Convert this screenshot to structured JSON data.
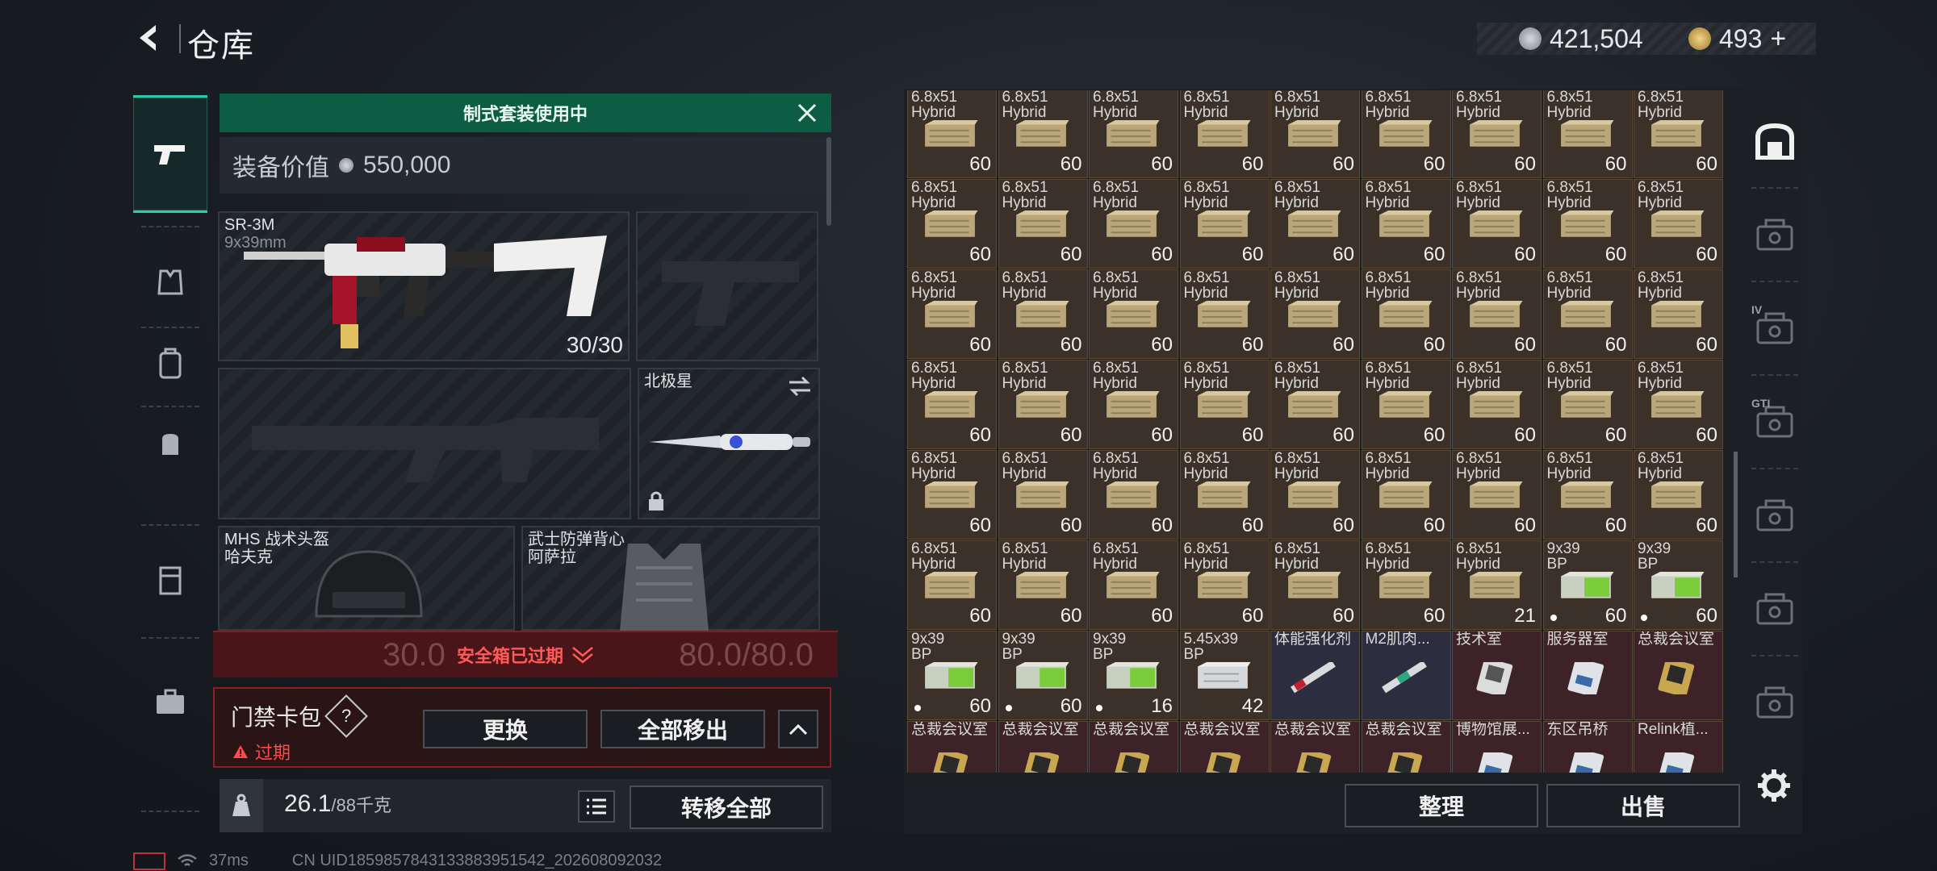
{
  "header": {
    "title": "仓库"
  },
  "currency": {
    "silver": "421,504",
    "gold": "493",
    "plus": "+"
  },
  "banner": {
    "text": "制式套装使用中"
  },
  "equipment": {
    "value_label": "装备价值",
    "value": "550,000",
    "primary": {
      "name": "SR-3M",
      "caliber": "9x39mm",
      "ammo": "30/30"
    },
    "melee": {
      "name": "北极星"
    },
    "helmet": {
      "name1": "MHS 战术头盔",
      "name2": "哈夫克",
      "durability": "30.0"
    },
    "armor": {
      "name1": "武士防弹背心",
      "name2": "阿萨拉",
      "durability": "80.0/80.0"
    }
  },
  "safe_box": {
    "text": "安全箱已过期"
  },
  "keybag": {
    "title": "门禁卡包",
    "help": "?",
    "status": "过期",
    "replace_label": "更换",
    "remove_all_label": "全部移出"
  },
  "capacity": {
    "current": "26.1",
    "max": "/88千克"
  },
  "transfer_all_label": "转移全部",
  "inventory": {
    "actions": {
      "sort_label": "整理",
      "sell_label": "出售"
    },
    "items": [
      {
        "l1": "6.8x51",
        "l2": "Hybrid",
        "c": "60",
        "k": "ammo"
      },
      {
        "l1": "6.8x51",
        "l2": "Hybrid",
        "c": "60",
        "k": "ammo"
      },
      {
        "l1": "6.8x51",
        "l2": "Hybrid",
        "c": "60",
        "k": "ammo"
      },
      {
        "l1": "6.8x51",
        "l2": "Hybrid",
        "c": "60",
        "k": "ammo"
      },
      {
        "l1": "6.8x51",
        "l2": "Hybrid",
        "c": "60",
        "k": "ammo"
      },
      {
        "l1": "6.8x51",
        "l2": "Hybrid",
        "c": "60",
        "k": "ammo"
      },
      {
        "l1": "6.8x51",
        "l2": "Hybrid",
        "c": "60",
        "k": "ammo"
      },
      {
        "l1": "6.8x51",
        "l2": "Hybrid",
        "c": "60",
        "k": "ammo"
      },
      {
        "l1": "6.8x51",
        "l2": "Hybrid",
        "c": "60",
        "k": "ammo"
      },
      {
        "l1": "6.8x51",
        "l2": "Hybrid",
        "c": "60",
        "k": "ammo"
      },
      {
        "l1": "6.8x51",
        "l2": "Hybrid",
        "c": "60",
        "k": "ammo"
      },
      {
        "l1": "6.8x51",
        "l2": "Hybrid",
        "c": "60",
        "k": "ammo"
      },
      {
        "l1": "6.8x51",
        "l2": "Hybrid",
        "c": "60",
        "k": "ammo"
      },
      {
        "l1": "6.8x51",
        "l2": "Hybrid",
        "c": "60",
        "k": "ammo"
      },
      {
        "l1": "6.8x51",
        "l2": "Hybrid",
        "c": "60",
        "k": "ammo"
      },
      {
        "l1": "6.8x51",
        "l2": "Hybrid",
        "c": "60",
        "k": "ammo"
      },
      {
        "l1": "6.8x51",
        "l2": "Hybrid",
        "c": "60",
        "k": "ammo"
      },
      {
        "l1": "6.8x51",
        "l2": "Hybrid",
        "c": "60",
        "k": "ammo"
      },
      {
        "l1": "6.8x51",
        "l2": "Hybrid",
        "c": "60",
        "k": "ammo"
      },
      {
        "l1": "6.8x51",
        "l2": "Hybrid",
        "c": "60",
        "k": "ammo"
      },
      {
        "l1": "6.8x51",
        "l2": "Hybrid",
        "c": "60",
        "k": "ammo"
      },
      {
        "l1": "6.8x51",
        "l2": "Hybrid",
        "c": "60",
        "k": "ammo"
      },
      {
        "l1": "6.8x51",
        "l2": "Hybrid",
        "c": "60",
        "k": "ammo"
      },
      {
        "l1": "6.8x51",
        "l2": "Hybrid",
        "c": "60",
        "k": "ammo"
      },
      {
        "l1": "6.8x51",
        "l2": "Hybrid",
        "c": "60",
        "k": "ammo"
      },
      {
        "l1": "6.8x51",
        "l2": "Hybrid",
        "c": "60",
        "k": "ammo"
      },
      {
        "l1": "6.8x51",
        "l2": "Hybrid",
        "c": "60",
        "k": "ammo"
      },
      {
        "l1": "6.8x51",
        "l2": "Hybrid",
        "c": "60",
        "k": "ammo"
      },
      {
        "l1": "6.8x51",
        "l2": "Hybrid",
        "c": "60",
        "k": "ammo"
      },
      {
        "l1": "6.8x51",
        "l2": "Hybrid",
        "c": "60",
        "k": "ammo"
      },
      {
        "l1": "6.8x51",
        "l2": "Hybrid",
        "c": "60",
        "k": "ammo"
      },
      {
        "l1": "6.8x51",
        "l2": "Hybrid",
        "c": "60",
        "k": "ammo"
      },
      {
        "l1": "6.8x51",
        "l2": "Hybrid",
        "c": "60",
        "k": "ammo"
      },
      {
        "l1": "6.8x51",
        "l2": "Hybrid",
        "c": "60",
        "k": "ammo"
      },
      {
        "l1": "6.8x51",
        "l2": "Hybrid",
        "c": "60",
        "k": "ammo"
      },
      {
        "l1": "6.8x51",
        "l2": "Hybrid",
        "c": "60",
        "k": "ammo"
      },
      {
        "l1": "6.8x51",
        "l2": "Hybrid",
        "c": "60",
        "k": "ammo"
      },
      {
        "l1": "6.8x51",
        "l2": "Hybrid",
        "c": "60",
        "k": "ammo"
      },
      {
        "l1": "6.8x51",
        "l2": "Hybrid",
        "c": "60",
        "k": "ammo"
      },
      {
        "l1": "6.8x51",
        "l2": "Hybrid",
        "c": "60",
        "k": "ammo"
      },
      {
        "l1": "6.8x51",
        "l2": "Hybrid",
        "c": "60",
        "k": "ammo"
      },
      {
        "l1": "6.8x51",
        "l2": "Hybrid",
        "c": "60",
        "k": "ammo"
      },
      {
        "l1": "6.8x51",
        "l2": "Hybrid",
        "c": "60",
        "k": "ammo"
      },
      {
        "l1": "6.8x51",
        "l2": "Hybrid",
        "c": "60",
        "k": "ammo"
      },
      {
        "l1": "6.8x51",
        "l2": "Hybrid",
        "c": "60",
        "k": "ammo"
      },
      {
        "l1": "6.8x51",
        "l2": "Hybrid",
        "c": "60",
        "k": "ammo"
      },
      {
        "l1": "6.8x51",
        "l2": "Hybrid",
        "c": "60",
        "k": "ammo"
      },
      {
        "l1": "6.8x51",
        "l2": "Hybrid",
        "c": "60",
        "k": "ammo"
      },
      {
        "l1": "6.8x51",
        "l2": "Hybrid",
        "c": "60",
        "k": "ammo"
      },
      {
        "l1": "6.8x51",
        "l2": "Hybrid",
        "c": "60",
        "k": "ammo"
      },
      {
        "l1": "6.8x51",
        "l2": "Hybrid",
        "c": "60",
        "k": "ammo"
      },
      {
        "l1": "6.8x51",
        "l2": "Hybrid",
        "c": "21",
        "k": "ammo"
      },
      {
        "l1": "9x39",
        "l2": "BP",
        "c": "60",
        "k": "green",
        "dot": true
      },
      {
        "l1": "9x39",
        "l2": "BP",
        "c": "60",
        "k": "green",
        "dot": true
      },
      {
        "l1": "9x39",
        "l2": "BP",
        "c": "60",
        "k": "green",
        "dot": true
      },
      {
        "l1": "9x39",
        "l2": "BP",
        "c": "60",
        "k": "green",
        "dot": true
      },
      {
        "l1": "9x39",
        "l2": "BP",
        "c": "16",
        "k": "green",
        "dot": true
      },
      {
        "l1": "5.45x39",
        "l2": "BP",
        "c": "42",
        "k": "silver"
      },
      {
        "l1": "体能强化剂",
        "l2": "",
        "c": "",
        "k": "inject1"
      },
      {
        "l1": "M2肌肉...",
        "l2": "",
        "c": "",
        "k": "inject2"
      },
      {
        "l1": "技术室",
        "l2": "",
        "c": "",
        "k": "card1"
      },
      {
        "l1": "服务器室",
        "l2": "",
        "c": "",
        "k": "card2"
      },
      {
        "l1": "总裁会议室",
        "l2": "",
        "c": "",
        "k": "card3"
      },
      {
        "l1": "总裁会议室",
        "l2": "",
        "c": "",
        "k": "card3"
      },
      {
        "l1": "总裁会议室",
        "l2": "",
        "c": "",
        "k": "card3"
      },
      {
        "l1": "总裁会议室",
        "l2": "",
        "c": "",
        "k": "card3"
      },
      {
        "l1": "总裁会议室",
        "l2": "",
        "c": "",
        "k": "card3"
      },
      {
        "l1": "总裁会议室",
        "l2": "",
        "c": "",
        "k": "card3"
      },
      {
        "l1": "总裁会议室",
        "l2": "",
        "c": "",
        "k": "card3"
      },
      {
        "l1": "博物馆展...",
        "l2": "",
        "c": "",
        "k": "card2"
      },
      {
        "l1": "东区吊桥",
        "l2": "",
        "c": "",
        "k": "card2"
      },
      {
        "l1": "Relink植...",
        "l2": "",
        "c": "",
        "k": "card2"
      }
    ]
  },
  "right_tabs": [
    {
      "icon": "storage-icon",
      "label": ""
    },
    {
      "icon": "case-icon",
      "label": ""
    },
    {
      "icon": "case-icon",
      "label": "IV"
    },
    {
      "icon": "case-icon",
      "label": "GTI"
    },
    {
      "icon": "case-icon",
      "label": ""
    },
    {
      "icon": "case-icon",
      "label": ""
    },
    {
      "icon": "case-icon",
      "label": ""
    }
  ],
  "status": {
    "ping": "37ms",
    "uid": "CN UID1859857843133883951542_202608092032"
  },
  "colors": {
    "accent": "#2ec9a9",
    "banner": "#0d5d45",
    "alert": "#ff4a4a",
    "ammo_bg": "#3a3128",
    "card_bg": "#3b2026"
  }
}
